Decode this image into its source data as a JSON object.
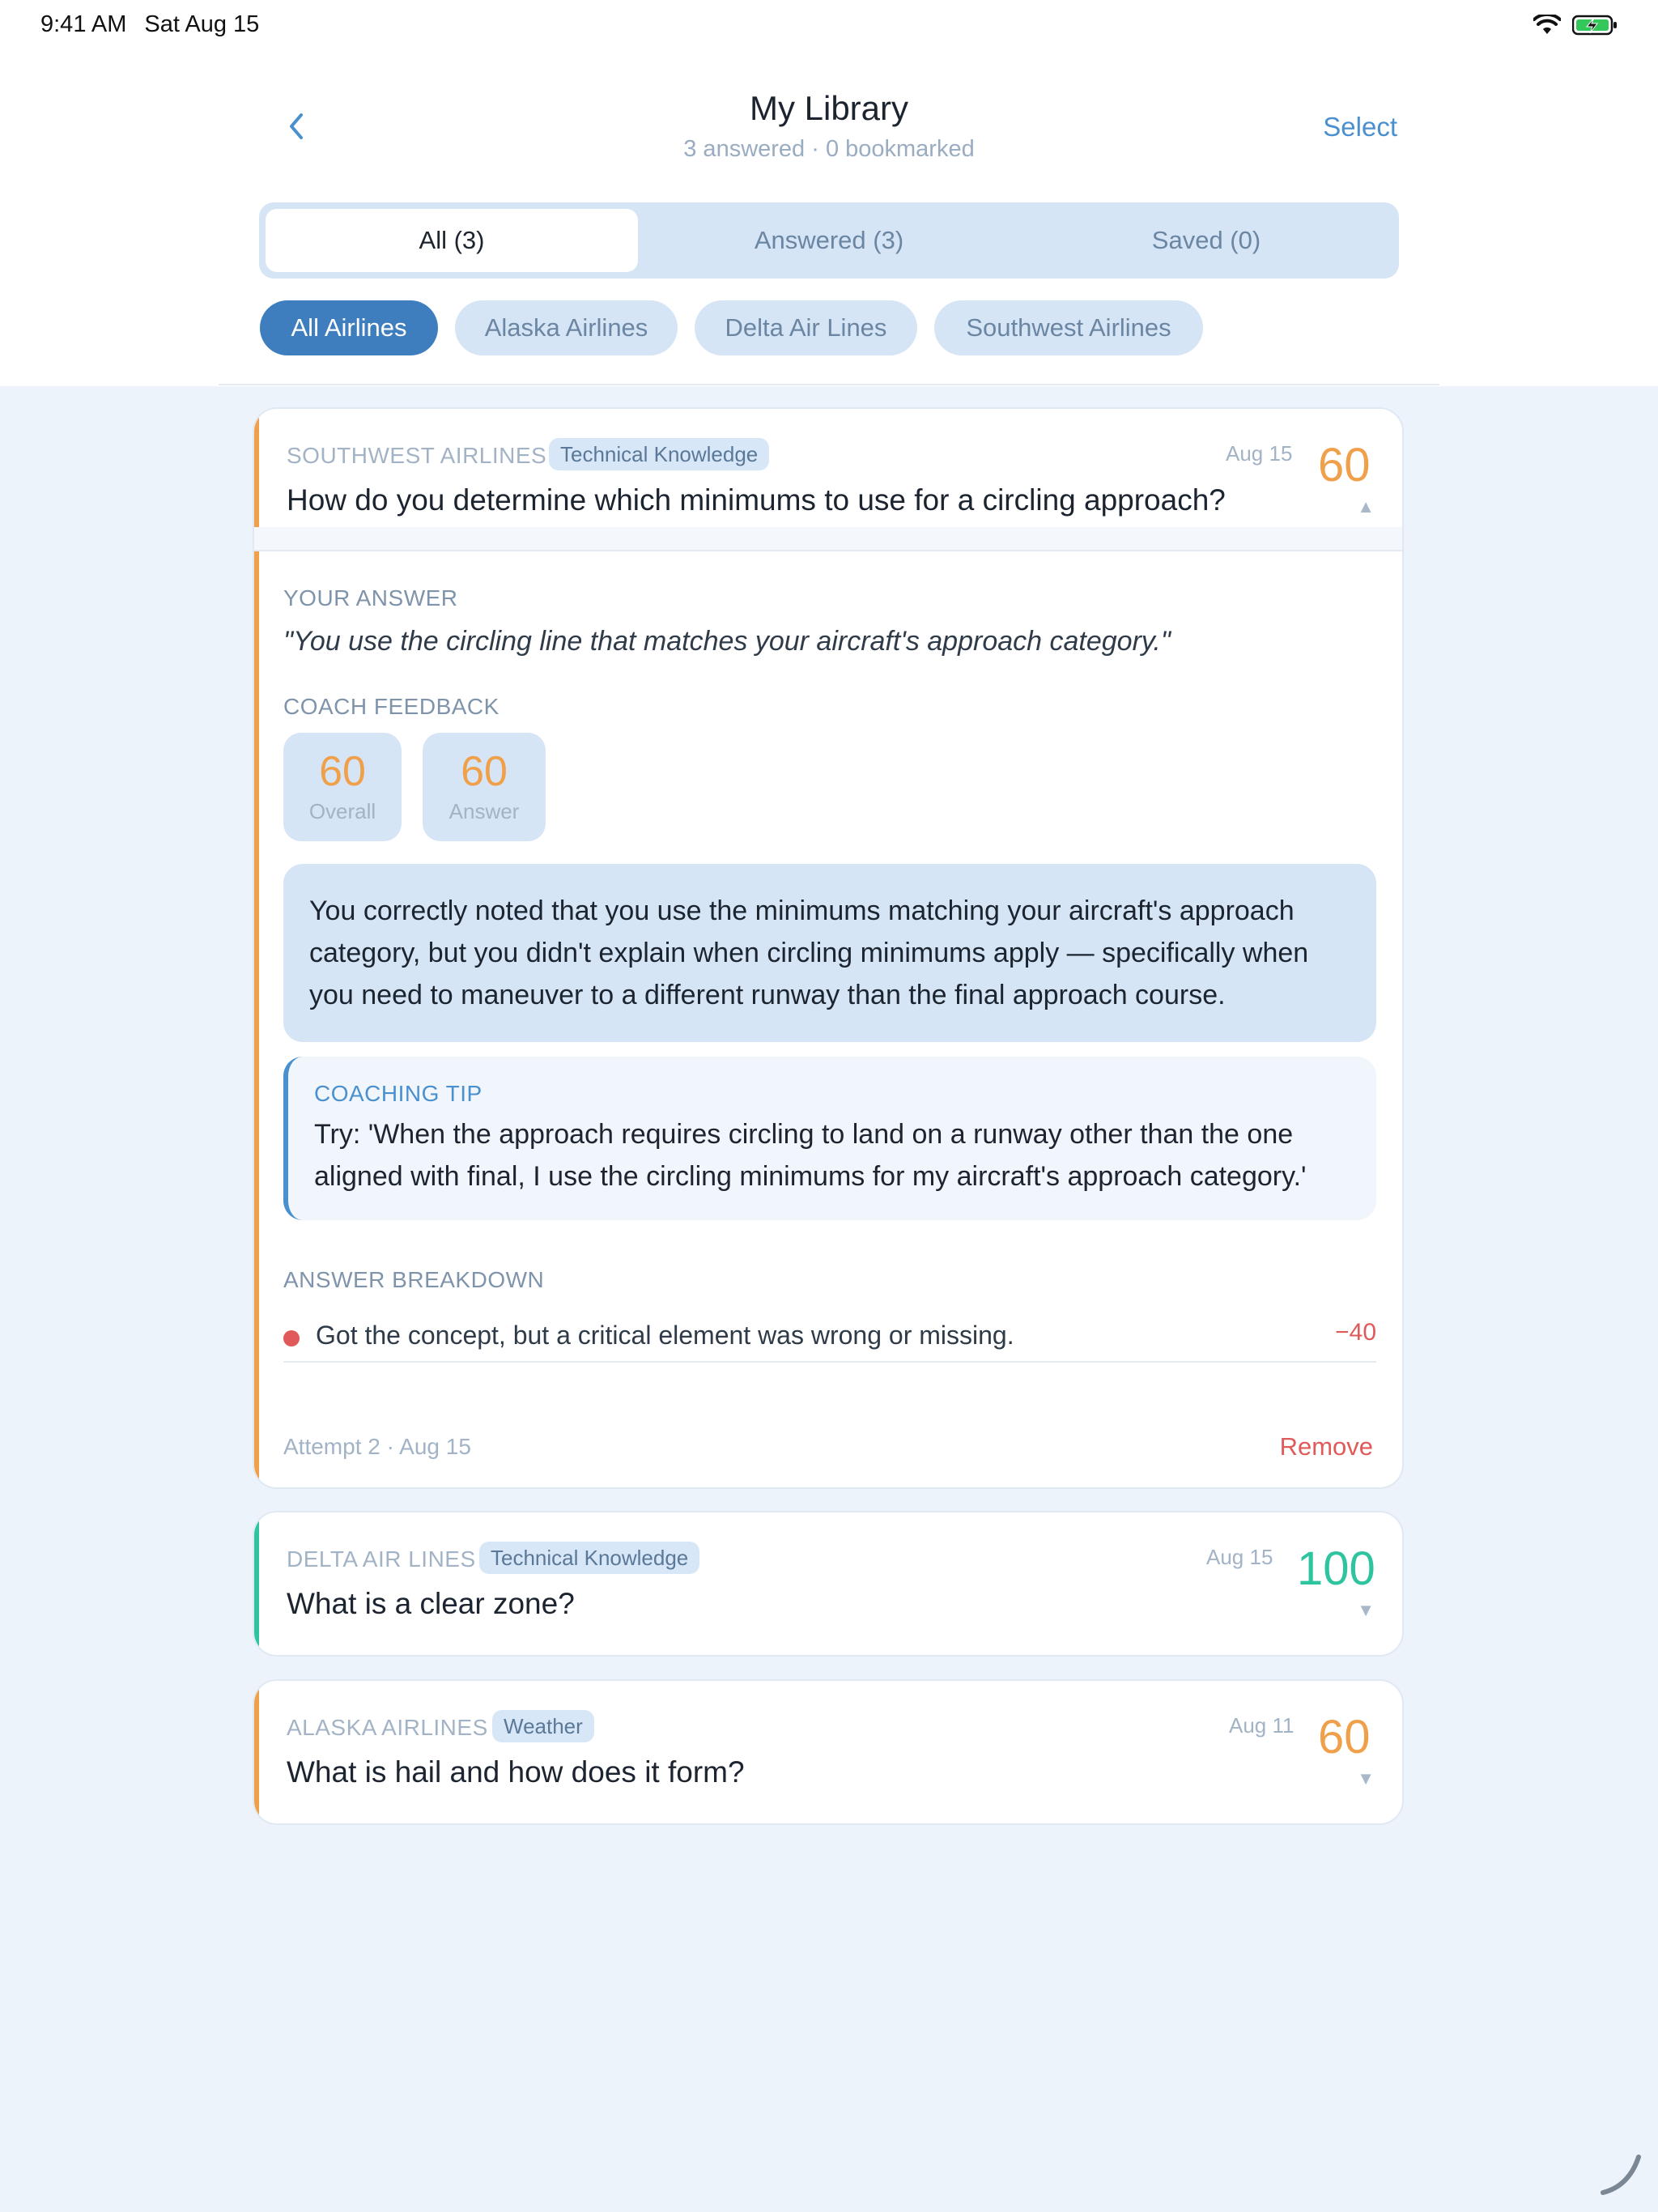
{
  "status": {
    "time": "9:41 AM",
    "date": "Sat Aug 15"
  },
  "header": {
    "title": "My Library",
    "subtitle": "3 answered · 0 bookmarked",
    "select_label": "Select"
  },
  "tabs": [
    {
      "label": "All (3)",
      "active": true
    },
    {
      "label": "Answered (3)",
      "active": false
    },
    {
      "label": "Saved (0)",
      "active": false
    }
  ],
  "filters": [
    {
      "label": "All Airlines",
      "active": true
    },
    {
      "label": "Alaska Airlines",
      "active": false
    },
    {
      "label": "Delta Air Lines",
      "active": false
    },
    {
      "label": "Southwest Airlines",
      "active": false
    }
  ],
  "colors": {
    "accent_orange": "#F0A04B",
    "accent_green": "#2EC4A0",
    "accent_blue": "#4A90CF",
    "danger": "#E05A5A"
  },
  "cards": [
    {
      "airline": "SOUTHWEST AIRLINES",
      "tag": "Technical Knowledge",
      "date": "Aug 15",
      "score": "60",
      "question": "How do you determine which minimums to use for a circling approach?",
      "expanded": true,
      "your_answer_label": "YOUR ANSWER",
      "your_answer": "\"You use the circling line that matches your aircraft's approach category.\"",
      "coach_feedback_label": "COACH FEEDBACK",
      "overall_score": "60",
      "overall_label": "Overall",
      "answer_score": "60",
      "answer_label": "Answer",
      "feedback": "You correctly noted that you use the minimums matching your aircraft's approach category, but you didn't explain when circling minimums apply — specifically when you need to maneuver to a different runway than the final approach course.",
      "tip_label": "COACHING TIP",
      "tip": "Try: 'When the approach requires circling to land on a runway other than the one aligned with final, I use the circling minimums for my aircraft's approach category.'",
      "breakdown_label": "ANSWER BREAKDOWN",
      "breakdown_text": "Got the concept, but a critical element was wrong or missing.",
      "breakdown_points": "−40",
      "attempt": "Attempt 2 · Aug 15",
      "remove_label": "Remove"
    },
    {
      "airline": "DELTA AIR LINES",
      "tag": "Technical Knowledge",
      "date": "Aug 15",
      "score": "100",
      "question": "What is a clear zone?"
    },
    {
      "airline": "ALASKA AIRLINES",
      "tag": "Weather",
      "date": "Aug 11",
      "score": "60",
      "question": "What is hail and how does it form?"
    }
  ],
  "icons": {
    "back": "chevron-left-icon",
    "wifi": "wifi-icon",
    "battery": "battery-charging-icon"
  }
}
